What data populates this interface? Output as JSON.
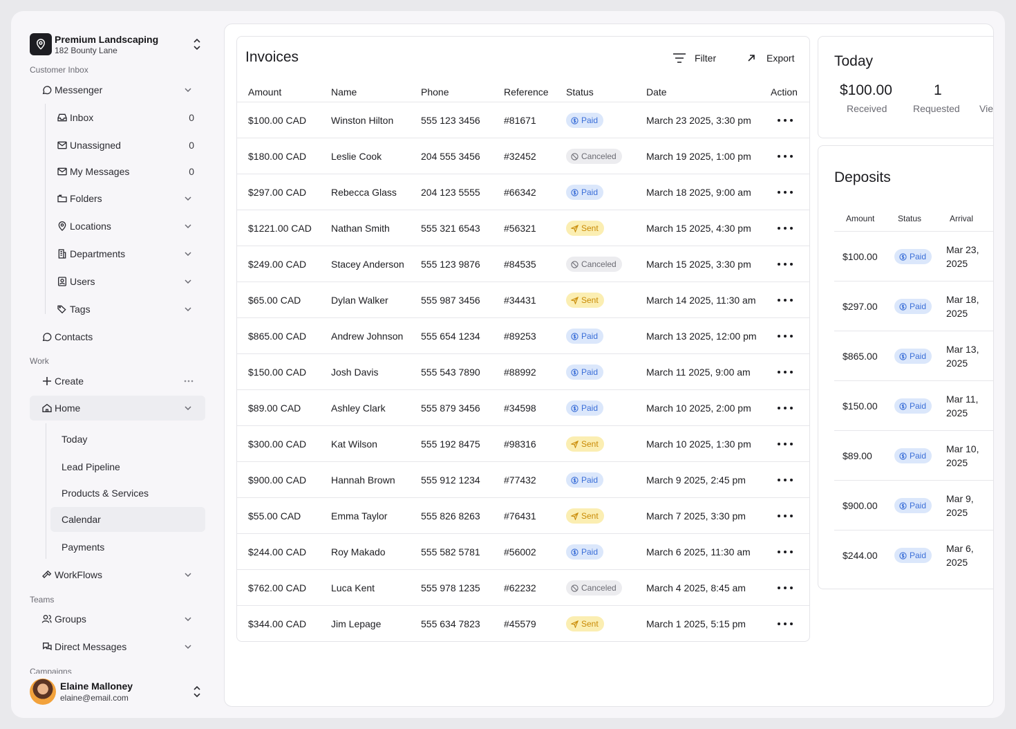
{
  "org": {
    "name": "Premium Landscaping",
    "address": "182 Bounty Lane"
  },
  "sidebar": {
    "customer_inbox_label": "Customer Inbox",
    "messenger": "Messenger",
    "inbox_items": [
      {
        "label": "Inbox",
        "count": "0"
      },
      {
        "label": "Unassigned",
        "count": "0"
      },
      {
        "label": "My Messages",
        "count": "0"
      }
    ],
    "folders": "Folders",
    "locations": "Locations",
    "departments": "Departments",
    "users": "Users",
    "tags": "Tags",
    "contacts": "Contacts",
    "work_label": "Work",
    "create": "Create",
    "home": "Home",
    "home_items": [
      "Today",
      "Lead Pipeline",
      "Products & Services",
      "Calendar",
      "Payments"
    ],
    "workflows": "WorkFlows",
    "teams_label": "Teams",
    "groups": "Groups",
    "direct_messages": "Direct Messages",
    "campaigns_label": "Campaigns"
  },
  "user": {
    "name": "Elaine Malloney",
    "email": "elaine@email.com"
  },
  "invoices": {
    "title": "Invoices",
    "filter_label": "Filter",
    "export_label": "Export",
    "columns": [
      "Amount",
      "Name",
      "Phone",
      "Reference",
      "Status",
      "Date",
      "Action"
    ],
    "rows": [
      {
        "amount": "$100.00 CAD",
        "name": "Winston Hilton",
        "phone": "555 123 3456",
        "ref": "#81671",
        "status": "Paid",
        "date": "March 23 2025, 3:30 pm"
      },
      {
        "amount": "$180.00 CAD",
        "name": "Leslie Cook",
        "phone": "204 555 3456",
        "ref": "#32452",
        "status": "Canceled",
        "date": "March 19 2025, 1:00 pm"
      },
      {
        "amount": "$297.00 CAD",
        "name": "Rebecca Glass",
        "phone": "204 123 5555",
        "ref": "#66342",
        "status": "Paid",
        "date": "March 18 2025, 9:00 am"
      },
      {
        "amount": "$1221.00 CAD",
        "name": "Nathan Smith",
        "phone": "555 321 6543",
        "ref": "#56321",
        "status": "Sent",
        "date": "March 15 2025, 4:30 pm"
      },
      {
        "amount": "$249.00 CAD",
        "name": "Stacey Anderson",
        "phone": "555 123 9876",
        "ref": "#84535",
        "status": "Canceled",
        "date": "March 15 2025, 3:30 pm"
      },
      {
        "amount": "$65.00 CAD",
        "name": "Dylan Walker",
        "phone": "555 987 3456",
        "ref": "#34431",
        "status": "Sent",
        "date": "March 14 2025, 11:30 am"
      },
      {
        "amount": "$865.00 CAD",
        "name": "Andrew Johnson",
        "phone": "555 654 1234",
        "ref": "#89253",
        "status": "Paid",
        "date": "March 13 2025, 12:00 pm"
      },
      {
        "amount": "$150.00 CAD",
        "name": "Josh Davis",
        "phone": "555 543 7890",
        "ref": "#88992",
        "status": "Paid",
        "date": "March 11 2025, 9:00 am"
      },
      {
        "amount": "$89.00 CAD",
        "name": "Ashley Clark",
        "phone": "555 879 3456",
        "ref": "#34598",
        "status": "Paid",
        "date": "March 10 2025, 2:00 pm"
      },
      {
        "amount": "$300.00 CAD",
        "name": "Kat Wilson",
        "phone": "555 192 8475",
        "ref": "#98316",
        "status": "Sent",
        "date": "March 10 2025, 1:30 pm"
      },
      {
        "amount": "$900.00 CAD",
        "name": "Hannah Brown",
        "phone": "555 912 1234",
        "ref": "#77432",
        "status": "Paid",
        "date": "March 9 2025, 2:45 pm"
      },
      {
        "amount": "$55.00 CAD",
        "name": "Emma Taylor",
        "phone": "555 826 8263",
        "ref": "#76431",
        "status": "Sent",
        "date": "March 7 2025, 3:30 pm"
      },
      {
        "amount": "$244.00 CAD",
        "name": "Roy Makado",
        "phone": "555 582 5781",
        "ref": "#56002",
        "status": "Paid",
        "date": "March 6 2025, 11:30 am"
      },
      {
        "amount": "$762.00 CAD",
        "name": "Luca Kent",
        "phone": "555 978 1235",
        "ref": "#62232",
        "status": "Canceled",
        "date": "March 4 2025, 8:45 am"
      },
      {
        "amount": "$344.00 CAD",
        "name": "Jim Lepage",
        "phone": "555 634 7823",
        "ref": "#45579",
        "status": "Sent",
        "date": "March 1 2025, 5:15 pm"
      }
    ]
  },
  "today": {
    "title": "Today",
    "stats": [
      {
        "value": "$100.00",
        "label": "Received"
      },
      {
        "value": "1",
        "label": "Requested"
      },
      {
        "value": "",
        "label": "Vie"
      }
    ]
  },
  "deposits": {
    "title": "Deposits",
    "columns": [
      "Amount",
      "Status",
      "Arrival"
    ],
    "rows": [
      {
        "amount": "$100.00",
        "status": "Paid",
        "arrival": "Mar 23, 2025"
      },
      {
        "amount": "$297.00",
        "status": "Paid",
        "arrival": "Mar 18, 2025"
      },
      {
        "amount": "$865.00",
        "status": "Paid",
        "arrival": "Mar 13, 2025"
      },
      {
        "amount": "$150.00",
        "status": "Paid",
        "arrival": "Mar 11, 2025"
      },
      {
        "amount": "$89.00",
        "status": "Paid",
        "arrival": "Mar 10, 2025"
      },
      {
        "amount": "$900.00",
        "status": "Paid",
        "arrival": "Mar 9, 2025"
      },
      {
        "amount": "$244.00",
        "status": "Paid",
        "arrival": "Mar 6, 2025"
      }
    ]
  },
  "colors": {
    "paid_bg": "#dbe7fb",
    "paid_fg": "#3b6fd8",
    "sent_bg": "#fbeeb2",
    "sent_fg": "#c98a05",
    "canceled_bg": "#ececef",
    "canceled_fg": "#6b6b73"
  }
}
